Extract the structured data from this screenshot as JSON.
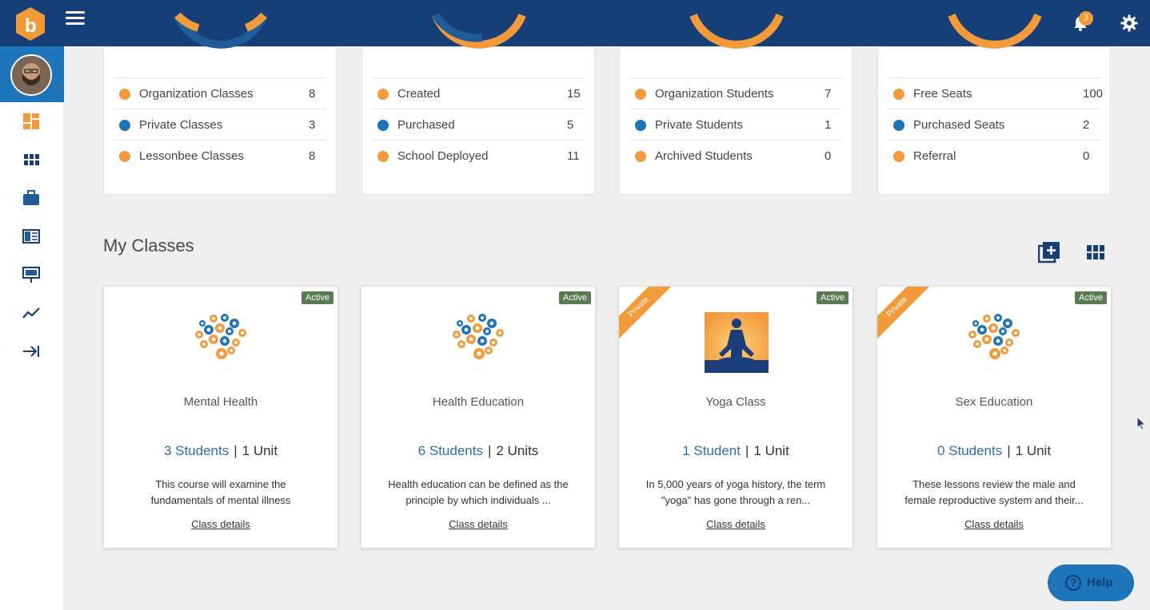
{
  "topbar": {
    "notification_count": "3"
  },
  "colors": {
    "primary": "#163f78",
    "accent_orange": "#f39a3b",
    "accent_blue": "#1e74b8"
  },
  "stats": [
    {
      "rows": [
        {
          "label": "Organization Classes",
          "value": "8",
          "color": "#f39a3b"
        },
        {
          "label": "Private Classes",
          "value": "3",
          "color": "#1e74b8"
        },
        {
          "label": "Lessonbee Classes",
          "value": "8",
          "color": "#f39a3b"
        }
      ]
    },
    {
      "rows": [
        {
          "label": "Created",
          "value": "15",
          "color": "#f39a3b"
        },
        {
          "label": "Purchased",
          "value": "5",
          "color": "#1e74b8"
        },
        {
          "label": "School Deployed",
          "value": "11",
          "color": "#f39a3b"
        }
      ]
    },
    {
      "rows": [
        {
          "label": "Organization Students",
          "value": "7",
          "color": "#f39a3b"
        },
        {
          "label": "Private Students",
          "value": "1",
          "color": "#1e74b8"
        },
        {
          "label": "Archived Students",
          "value": "0",
          "color": "#f39a3b"
        }
      ]
    },
    {
      "rows": [
        {
          "label": "Free Seats",
          "value": "100",
          "color": "#f39a3b"
        },
        {
          "label": "Purchased Seats",
          "value": "2",
          "color": "#1e74b8"
        },
        {
          "label": "Referral",
          "value": "0",
          "color": "#f39a3b"
        }
      ]
    }
  ],
  "section": {
    "title": "My Classes"
  },
  "classes": [
    {
      "name": "Mental Health",
      "status": "Active",
      "ribbon": "",
      "students": "3 Students",
      "units": "1 Unit",
      "desc_line1": "This course will examine the",
      "desc_line2": "fundamentals of mental illness",
      "details": "Class details"
    },
    {
      "name": "Health Education",
      "status": "Active",
      "ribbon": "",
      "students": "6 Students",
      "units": "2 Units",
      "desc_line1": "Health education can be defined as the",
      "desc_line2": "principle by which individuals ...",
      "details": "Class details"
    },
    {
      "name": "Yoga Class",
      "status": "Active",
      "ribbon": "Private",
      "students": "1 Student",
      "units": "1 Unit",
      "desc_line1": "In 5,000 years of yoga history, the term",
      "desc_line2": "\"yoga\" has gone through a ren...",
      "details": "Class details"
    },
    {
      "name": "Sex Education",
      "status": "Active",
      "ribbon": "Private",
      "students": "0 Students",
      "units": "1 Unit",
      "desc_line1": "These lessons review the male and",
      "desc_line2": "female reproductive system and their...",
      "details": "Class details"
    }
  ],
  "help": {
    "label": "Help"
  }
}
